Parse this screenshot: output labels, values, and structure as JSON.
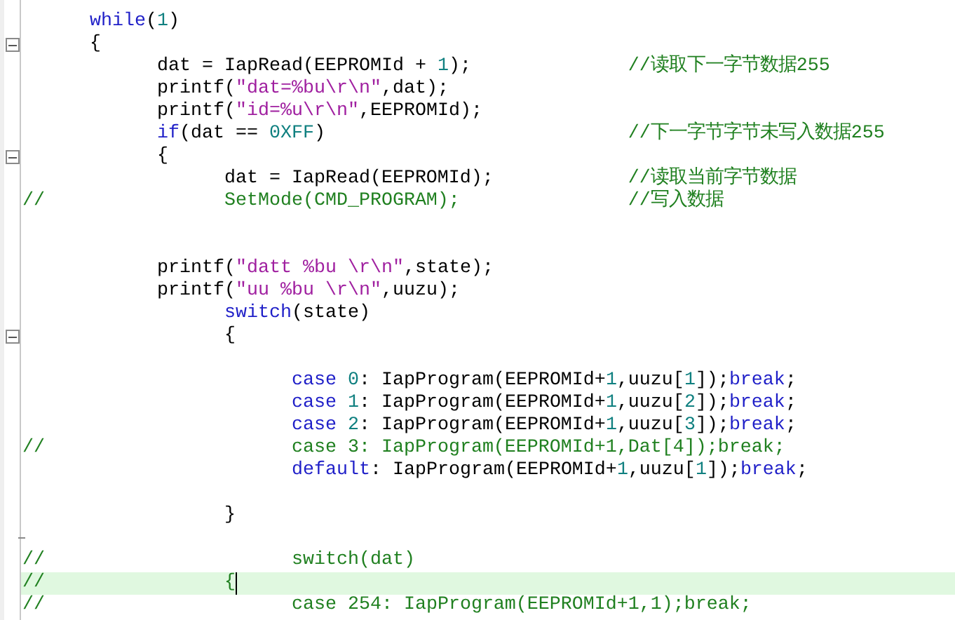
{
  "editor": {
    "lines": [
      {
        "current": false,
        "fold_start": false,
        "fold_end": false,
        "segments": [
          {
            "kind": "code",
            "tokens": [
              {
                "kind": "keyword",
                "text": "\twhile"
              },
              {
                "kind": "plain",
                "text": "("
              },
              {
                "kind": "number",
                "text": "1"
              },
              {
                "kind": "plain",
                "text": ")"
              }
            ]
          }
        ]
      },
      {
        "current": false,
        "fold_start": true,
        "fold_end": false,
        "segments": [
          {
            "kind": "code",
            "tokens": [
              {
                "kind": "plain",
                "text": "\t{"
              }
            ]
          }
        ]
      },
      {
        "current": false,
        "fold_start": false,
        "fold_end": false,
        "segments": [
          {
            "kind": "code",
            "tokens": [
              {
                "kind": "plain",
                "text": "\t\tdat = IapRead(EEPROMId + "
              },
              {
                "kind": "number",
                "text": "1"
              },
              {
                "kind": "plain",
                "text": ");"
              }
            ]
          },
          {
            "kind": "comment",
            "text": "\t\t\t//读取下一字节数据255"
          }
        ]
      },
      {
        "current": false,
        "fold_start": false,
        "fold_end": false,
        "segments": [
          {
            "kind": "code",
            "tokens": [
              {
                "kind": "plain",
                "text": "\t\tprintf("
              },
              {
                "kind": "string",
                "text": "\"dat=%bu\\r\\n\""
              },
              {
                "kind": "plain",
                "text": ",dat);"
              }
            ]
          }
        ]
      },
      {
        "current": false,
        "fold_start": false,
        "fold_end": false,
        "segments": [
          {
            "kind": "code",
            "tokens": [
              {
                "kind": "plain",
                "text": "\t\tprintf("
              },
              {
                "kind": "string",
                "text": "\"id=%u\\r\\n\""
              },
              {
                "kind": "plain",
                "text": ",EEPROMId);"
              }
            ]
          }
        ]
      },
      {
        "current": false,
        "fold_start": false,
        "fold_end": false,
        "segments": [
          {
            "kind": "code",
            "tokens": [
              {
                "kind": "keyword",
                "text": "\t\tif"
              },
              {
                "kind": "plain",
                "text": "(dat == "
              },
              {
                "kind": "number",
                "text": "0XFF"
              },
              {
                "kind": "plain",
                "text": ")"
              }
            ]
          },
          {
            "kind": "comment",
            "text": "\t\t\t\t\t//下一字节字节未写入数据255"
          }
        ]
      },
      {
        "current": false,
        "fold_start": true,
        "fold_end": false,
        "segments": [
          {
            "kind": "code",
            "tokens": [
              {
                "kind": "plain",
                "text": "\t\t{"
              }
            ]
          }
        ]
      },
      {
        "current": false,
        "fold_start": false,
        "fold_end": false,
        "segments": [
          {
            "kind": "code",
            "tokens": [
              {
                "kind": "plain",
                "text": "\t\t\tdat = IapRead(EEPROMId);"
              }
            ]
          },
          {
            "kind": "comment",
            "text": "\t\t//读取当前字节数据"
          }
        ]
      },
      {
        "current": false,
        "fold_start": false,
        "fold_end": false,
        "segments": [
          {
            "kind": "comment",
            "text": "//"
          },
          {
            "kind": "comment",
            "text": "\t\t\tSetMode(CMD_PROGRAM);"
          },
          {
            "kind": "comment",
            "text": "\t\t\t//写入数据"
          }
        ]
      },
      {
        "current": false,
        "fold_start": false,
        "fold_end": false
      },
      {
        "current": false,
        "fold_start": false,
        "fold_end": false
      },
      {
        "current": false,
        "fold_start": false,
        "fold_end": false,
        "segments": [
          {
            "kind": "code",
            "tokens": [
              {
                "kind": "plain",
                "text": "\t\tprintf("
              },
              {
                "kind": "string",
                "text": "\"datt %bu \\r\\n\""
              },
              {
                "kind": "plain",
                "text": ",state);"
              }
            ]
          }
        ]
      },
      {
        "current": false,
        "fold_start": false,
        "fold_end": false,
        "segments": [
          {
            "kind": "code",
            "tokens": [
              {
                "kind": "plain",
                "text": "\t\tprintf("
              },
              {
                "kind": "string",
                "text": "\"uu %bu \\r\\n\""
              },
              {
                "kind": "plain",
                "text": ",uuzu);"
              }
            ]
          }
        ]
      },
      {
        "current": false,
        "fold_start": false,
        "fold_end": false,
        "segments": [
          {
            "kind": "code",
            "tokens": [
              {
                "kind": "keyword",
                "text": "\t\t\tswitch"
              },
              {
                "kind": "plain",
                "text": "(state)"
              }
            ]
          }
        ]
      },
      {
        "current": false,
        "fold_start": true,
        "fold_end": false,
        "segments": [
          {
            "kind": "code",
            "tokens": [
              {
                "kind": "plain",
                "text": "\t\t\t{"
              }
            ]
          }
        ]
      },
      {
        "current": false,
        "fold_start": false,
        "fold_end": false
      },
      {
        "current": false,
        "fold_start": false,
        "fold_end": false,
        "segments": [
          {
            "kind": "code",
            "tokens": [
              {
                "kind": "keyword",
                "text": "\t\t\t\tcase "
              },
              {
                "kind": "number",
                "text": "0"
              },
              {
                "kind": "plain",
                "text": ": IapProgram(EEPROMId+"
              },
              {
                "kind": "number",
                "text": "1"
              },
              {
                "kind": "plain",
                "text": ",uuzu["
              },
              {
                "kind": "number",
                "text": "1"
              },
              {
                "kind": "plain",
                "text": "]);"
              },
              {
                "kind": "keyword",
                "text": "break"
              },
              {
                "kind": "plain",
                "text": ";"
              }
            ]
          }
        ]
      },
      {
        "current": false,
        "fold_start": false,
        "fold_end": false,
        "segments": [
          {
            "kind": "code",
            "tokens": [
              {
                "kind": "keyword",
                "text": "\t\t\t\tcase "
              },
              {
                "kind": "number",
                "text": "1"
              },
              {
                "kind": "plain",
                "text": ": IapProgram(EEPROMId+"
              },
              {
                "kind": "number",
                "text": "1"
              },
              {
                "kind": "plain",
                "text": ",uuzu["
              },
              {
                "kind": "number",
                "text": "2"
              },
              {
                "kind": "plain",
                "text": "]);"
              },
              {
                "kind": "keyword",
                "text": "break"
              },
              {
                "kind": "plain",
                "text": ";"
              }
            ]
          }
        ]
      },
      {
        "current": false,
        "fold_start": false,
        "fold_end": false,
        "segments": [
          {
            "kind": "code",
            "tokens": [
              {
                "kind": "keyword",
                "text": "\t\t\t\tcase "
              },
              {
                "kind": "number",
                "text": "2"
              },
              {
                "kind": "plain",
                "text": ": IapProgram(EEPROMId+"
              },
              {
                "kind": "number",
                "text": "1"
              },
              {
                "kind": "plain",
                "text": ",uuzu["
              },
              {
                "kind": "number",
                "text": "3"
              },
              {
                "kind": "plain",
                "text": "]);"
              },
              {
                "kind": "keyword",
                "text": "break"
              },
              {
                "kind": "plain",
                "text": ";"
              }
            ]
          }
        ]
      },
      {
        "current": false,
        "fold_start": false,
        "fold_end": false,
        "segments": [
          {
            "kind": "comment",
            "text": "//"
          },
          {
            "kind": "comment",
            "text": "\t\t\t\tcase 3: IapProgram(EEPROMId+1,Dat[4]);break;"
          }
        ]
      },
      {
        "current": false,
        "fold_start": false,
        "fold_end": false,
        "segments": [
          {
            "kind": "code",
            "tokens": [
              {
                "kind": "keyword",
                "text": "\t\t\t\tdefault"
              },
              {
                "kind": "plain",
                "text": ": IapProgram(EEPROMId+"
              },
              {
                "kind": "number",
                "text": "1"
              },
              {
                "kind": "plain",
                "text": ",uuzu["
              },
              {
                "kind": "number",
                "text": "1"
              },
              {
                "kind": "plain",
                "text": "]);"
              },
              {
                "kind": "keyword",
                "text": "break"
              },
              {
                "kind": "plain",
                "text": ";"
              }
            ]
          }
        ]
      },
      {
        "current": false,
        "fold_start": false,
        "fold_end": false
      },
      {
        "current": false,
        "fold_start": false,
        "fold_end": false,
        "segments": [
          {
            "kind": "code",
            "tokens": [
              {
                "kind": "plain",
                "text": "\t\t\t}"
              }
            ]
          }
        ]
      },
      {
        "current": false,
        "fold_start": false,
        "fold_end": true
      },
      {
        "current": false,
        "fold_start": false,
        "fold_end": false,
        "segments": [
          {
            "kind": "comment",
            "text": "//"
          },
          {
            "kind": "comment",
            "text": "\t\t\t\tswitch(dat)"
          }
        ]
      },
      {
        "current": true,
        "fold_start": false,
        "fold_end": false,
        "segments": [
          {
            "kind": "comment",
            "text": "//"
          },
          {
            "kind": "comment",
            "text": "\t\t\t{"
          },
          {
            "kind": "cursor"
          }
        ]
      },
      {
        "current": false,
        "fold_start": false,
        "fold_end": false,
        "segments": [
          {
            "kind": "comment",
            "text": "//"
          },
          {
            "kind": "comment",
            "text": "\t\t\t\tcase 254: IapProgram(EEPROMId+1,1);break;"
          }
        ]
      }
    ]
  }
}
